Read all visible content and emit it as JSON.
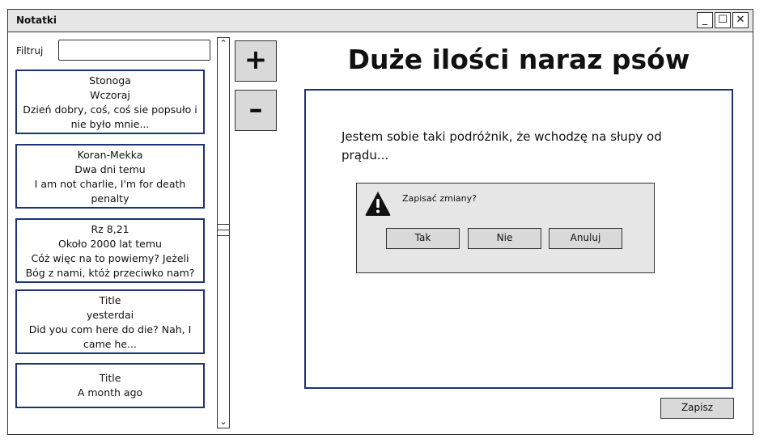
{
  "window": {
    "title": "Notatki",
    "controls": [
      "_",
      "☐",
      "✕"
    ]
  },
  "filter": {
    "label": "Filtruj",
    "value": ""
  },
  "notes": [
    {
      "title": "Stonoga",
      "date": "Wczoraj",
      "preview": "Dzień dobry, coś, coś sie popsuło i nie było mnie..."
    },
    {
      "title": "Koran-Mekka",
      "date": "Dwa dni temu",
      "preview": "I am not charlie, I'm for death penalty"
    },
    {
      "title": "Rz 8,21",
      "date": "Około 2000 lat temu",
      "preview": "Cóż więc na to powiemy? Jeżeli Bóg z nami, któż przeciwko nam?"
    },
    {
      "title": "Title",
      "date": "yesterdai",
      "preview": "Did you com here do die? Nah, I came he..."
    },
    {
      "title": "Title",
      "date": "A month ago",
      "preview": ""
    }
  ],
  "toolbar": {
    "add_label": "+",
    "remove_label": "–"
  },
  "note_view": {
    "heading": "Duże ilości naraz psów",
    "body": "Jestem sobie taki podróżnik, że wchodzę na słupy od prądu..."
  },
  "dialog": {
    "icon": "warning-icon",
    "message": "Zapisać zmiany?",
    "buttons": {
      "yes": "Tak",
      "no": "Nie",
      "cancel": "Anuluj"
    }
  },
  "save_label": "Zapisz",
  "colors": {
    "note_border": "#1f3277",
    "button_bg": "#d9d9d9",
    "dialog_bg": "#e6e6e6"
  }
}
